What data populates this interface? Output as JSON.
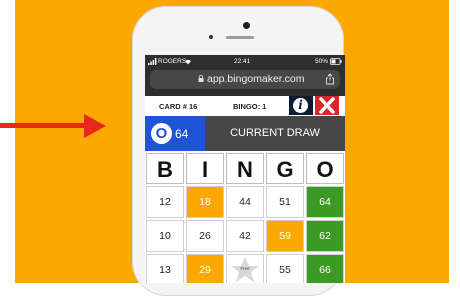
{
  "colors": {
    "background": "#fca800",
    "arrow": "#e8281e",
    "ball_blue": "#1f54d4",
    "marked_orange": "#fca800",
    "marked_green": "#3b9a23",
    "close_red": "#d9262c"
  },
  "status_bar": {
    "carrier": "ROGERS",
    "time": "22:41",
    "battery": "50%"
  },
  "browser": {
    "url": "app.bingomaker.com"
  },
  "card_bar": {
    "card_label": "CARD # 16",
    "bingo_label": "BINGO: 1"
  },
  "draw": {
    "letter": "O",
    "number": "64",
    "label": "CURRENT DRAW"
  },
  "card": {
    "columns": [
      "B",
      "I",
      "N",
      "G",
      "O"
    ],
    "free_label": "Free",
    "rows": [
      [
        {
          "v": "12",
          "m": ""
        },
        {
          "v": "18",
          "m": "orange"
        },
        {
          "v": "44",
          "m": ""
        },
        {
          "v": "51",
          "m": ""
        },
        {
          "v": "64",
          "m": "green"
        }
      ],
      [
        {
          "v": "10",
          "m": ""
        },
        {
          "v": "26",
          "m": ""
        },
        {
          "v": "42",
          "m": ""
        },
        {
          "v": "59",
          "m": "orange"
        },
        {
          "v": "62",
          "m": "green"
        }
      ],
      [
        {
          "v": "13",
          "m": ""
        },
        {
          "v": "29",
          "m": "orange"
        },
        {
          "v": "",
          "m": "free"
        },
        {
          "v": "55",
          "m": ""
        },
        {
          "v": "66",
          "m": "green"
        }
      ]
    ]
  }
}
